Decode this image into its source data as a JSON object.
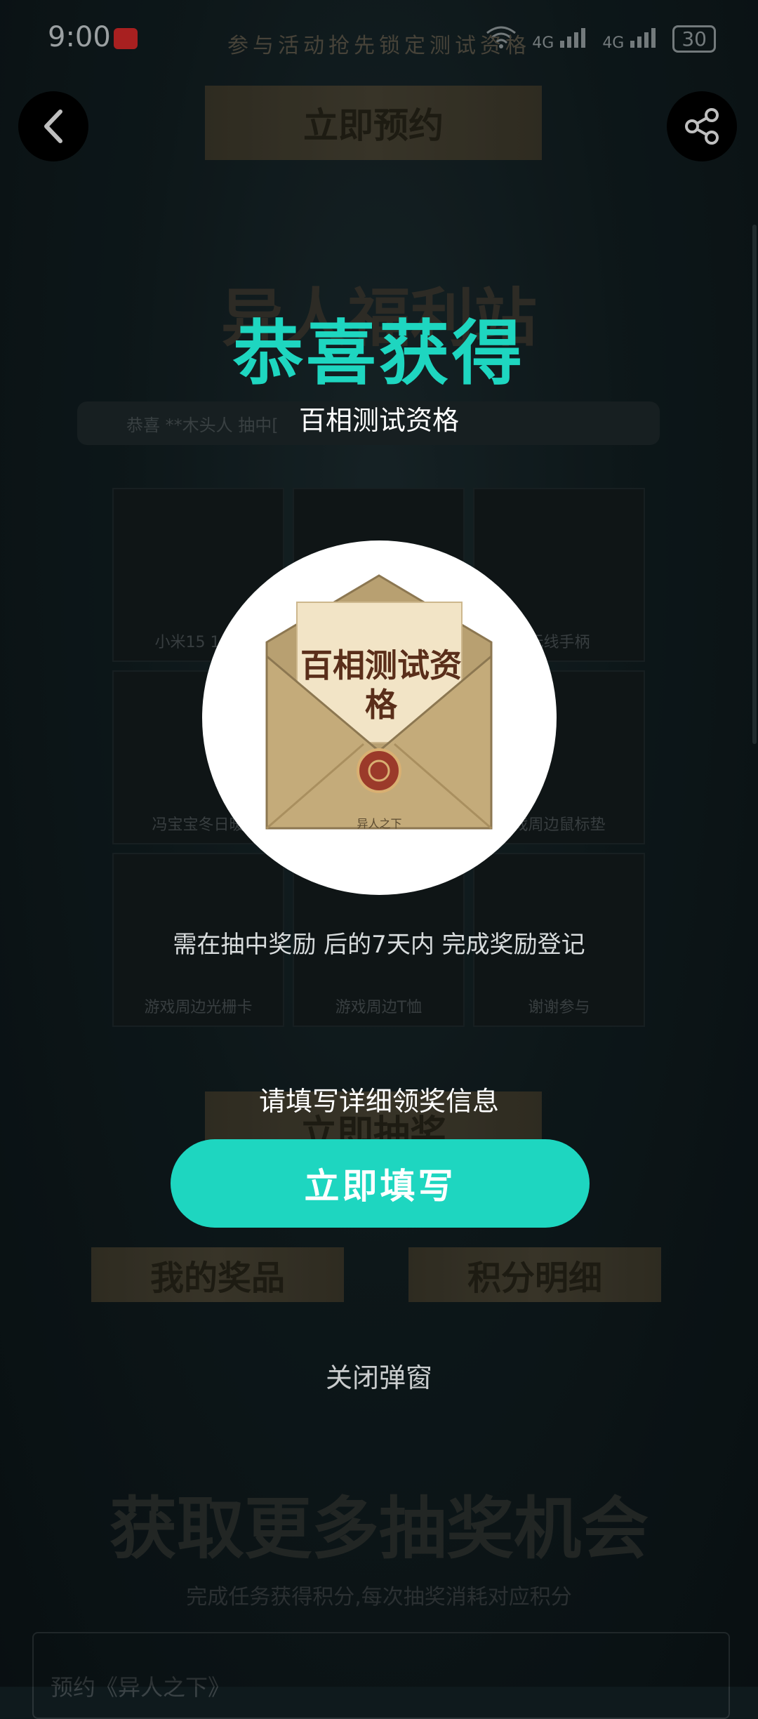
{
  "status_bar": {
    "time": "9:00",
    "signal_1": "4G",
    "signal_2": "4G",
    "battery": "30"
  },
  "background": {
    "top_banner": "参与活动抢先锁定测试资格",
    "reserve_button": "立即预约",
    "welfare_title": "异人福利站",
    "ticker_text": "恭喜 **木头人 抽中[",
    "grid_labels": [
      "小米15 16G",
      "",
      "无线手柄",
      "冯宝宝冬日暖",
      "",
      "戏周边鼠标垫",
      "游戏周边光栅卡",
      "游戏周边T恤",
      "谢谢参与"
    ],
    "draw_button": "立即抽奖",
    "my_prizes": "我的奖品",
    "points_detail": "积分明细",
    "more_title": "获取更多抽奖机会",
    "more_subtitle": "完成任务获得积分,每次抽奖消耗对应积分",
    "task_card": "预约《异人之下》"
  },
  "modal": {
    "title": "恭喜获得",
    "subtitle": "百相测试资格",
    "prize_image_text": "百相测试资格",
    "prize_seal_text": "异人之下",
    "note": "需在抽中奖励 后的7天内 完成奖励登记",
    "fill_hint": "请填写详细领奖信息",
    "fill_button": "立即填写",
    "close_link": "关闭弹窗"
  },
  "colors": {
    "accent": "#1ed6c0",
    "background": "#0f1a1d"
  }
}
